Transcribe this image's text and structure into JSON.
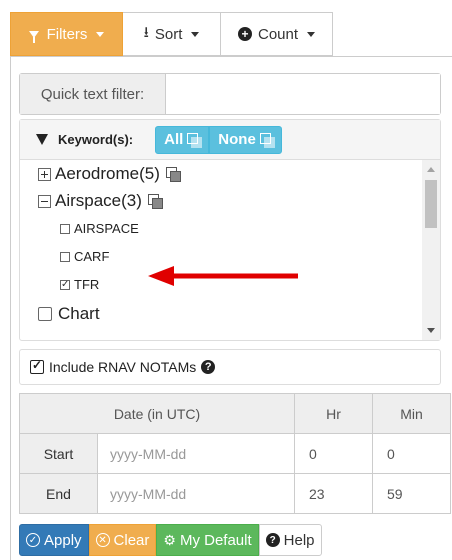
{
  "toolbar": {
    "filters_label": "Filters",
    "sort_label": "Sort",
    "count_label": "Count",
    "filters_icon": "funnel-icon",
    "sort_icon": "sort-icon",
    "count_icon": "plus-circle-icon"
  },
  "quick_filter": {
    "label": "Quick text filter:",
    "value": "",
    "placeholder": ""
  },
  "keywords": {
    "title": "Keyword(s):",
    "all_label": "All",
    "none_label": "None",
    "items": [
      {
        "label": "Aerodrome(5)",
        "expanded": false,
        "type": "group"
      },
      {
        "label": "Airspace(3)",
        "expanded": true,
        "type": "group",
        "children": [
          {
            "label": "AIRSPACE",
            "checked": false
          },
          {
            "label": "CARF",
            "checked": false
          },
          {
            "label": "TFR",
            "checked": true
          }
        ]
      },
      {
        "label": "Chart",
        "checked": false,
        "type": "leaf"
      }
    ]
  },
  "rnav": {
    "label": "Include RNAV NOTAMs",
    "checked": true
  },
  "date_table": {
    "headers": [
      "Date (in UTC)",
      "Hr",
      "Min"
    ],
    "rows": [
      {
        "label": "Start",
        "date_placeholder": "yyyy-MM-dd",
        "hr": "0",
        "min": "0"
      },
      {
        "label": "End",
        "date_placeholder": "yyyy-MM-dd",
        "hr": "23",
        "min": "59"
      }
    ]
  },
  "actions": {
    "apply": "Apply",
    "clear": "Clear",
    "default": "My Default",
    "help": "Help"
  },
  "colors": {
    "warning": "#f0ad4e",
    "info": "#5bc0de",
    "primary": "#337ab7",
    "success": "#5cb85c",
    "annotation_arrow": "#e00000"
  }
}
